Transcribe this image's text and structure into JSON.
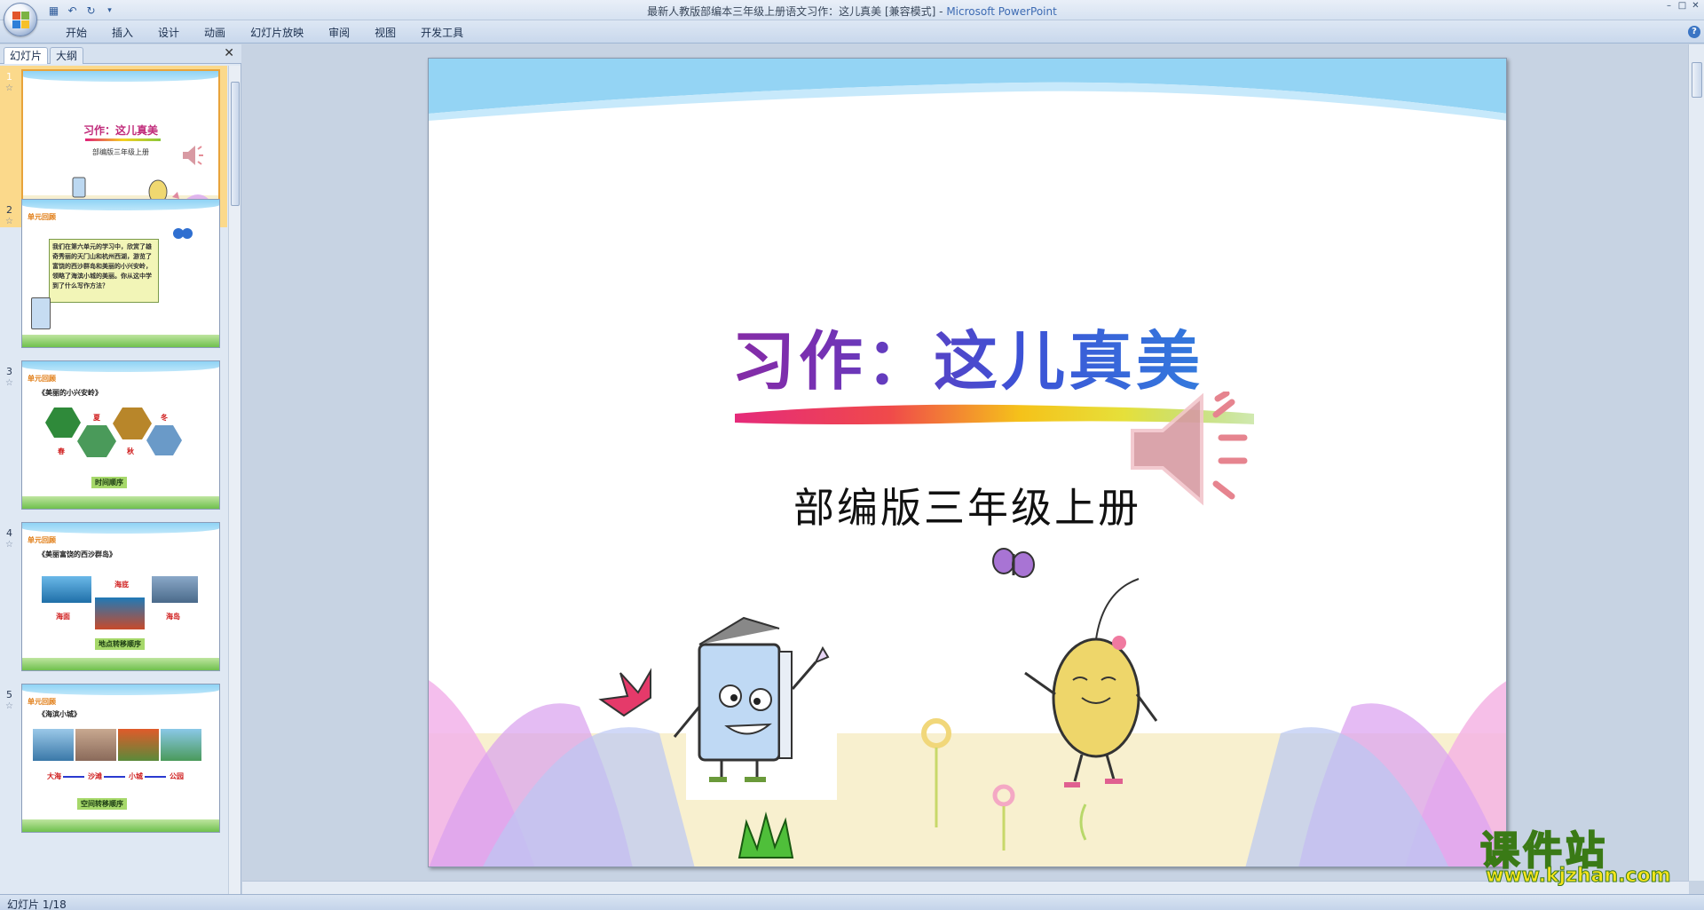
{
  "window": {
    "title": "最新人教版部编本三年级上册语文习作：这儿真美 [兼容模式] - ",
    "app_name": "Microsoft PowerPoint"
  },
  "ribbon": {
    "tabs": [
      "开始",
      "插入",
      "设计",
      "动画",
      "幻灯片放映",
      "审阅",
      "视图",
      "开发工具"
    ]
  },
  "pane": {
    "tab_slides": "幻灯片",
    "tab_outline": "大纲",
    "thumbnails": [
      {
        "num": "1",
        "title": "习作：这儿真美",
        "subtitle": "部编版三年级上册"
      },
      {
        "num": "2",
        "header": "单元回顾",
        "text": "我们在第六单元的学习中，欣赏了雄奇秀丽的天门山和杭州西湖，游览了富饶的西沙群岛和美丽的小兴安岭，领略了海滨小城的美丽。你从这中学到了什么写作方法？"
      },
      {
        "num": "3",
        "header": "单元回顾",
        "book": "《美丽的小兴安岭》",
        "labels": [
          "春",
          "夏",
          "秋",
          "冬"
        ],
        "pill": "时间顺序"
      },
      {
        "num": "4",
        "header": "单元回顾",
        "book": "《美丽富饶的西沙群岛》",
        "labels": [
          "海面",
          "海底",
          "海岛"
        ],
        "pill": "地点转移顺序"
      },
      {
        "num": "5",
        "header": "单元回顾",
        "book": "《海滨小城》",
        "labels": [
          "大海",
          "沙滩",
          "小城",
          "公园"
        ],
        "pill": "空间转移顺序"
      }
    ]
  },
  "slide": {
    "title": "习作：这儿真美",
    "subtitle": "部编版三年级上册"
  },
  "status": {
    "slide_indicator": "幻灯片 1/18"
  },
  "watermark": {
    "big": "课件站",
    "small": "www.kjzhan.com"
  },
  "colors": {
    "title_gradient_start": "#b0207a",
    "title_gradient_end": "#4aa4ef",
    "sky": "#8fd3f5",
    "selection": "#fbd98b"
  }
}
